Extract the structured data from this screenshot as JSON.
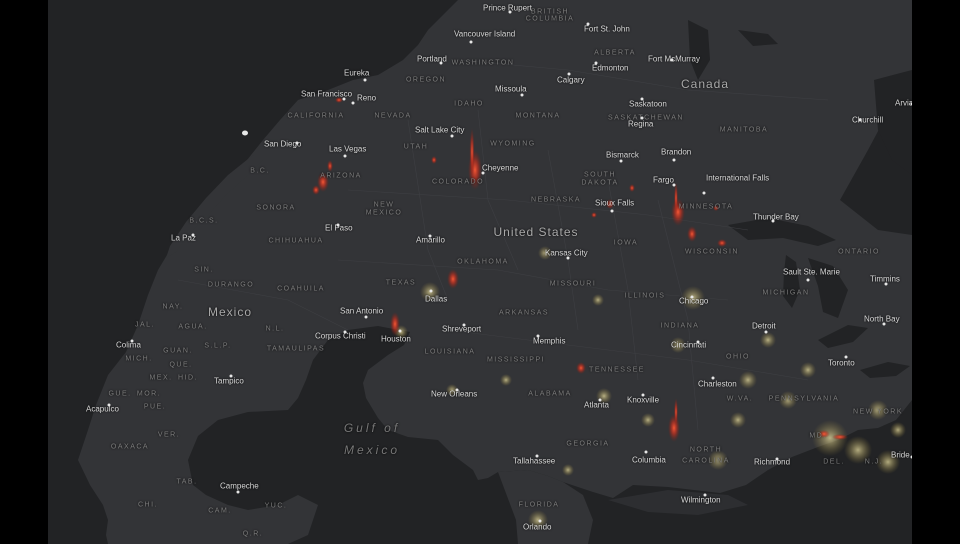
{
  "countries": [
    "Canada",
    "United States",
    "Mexico"
  ],
  "water": [
    "Gulf of",
    "Mexico"
  ],
  "states": [
    "BRITISH",
    "COLUMBIA",
    "ALBERTA",
    "WASHINGTON",
    "OREGON",
    "IDAHO",
    "MONTANA",
    "CALIFORNIA",
    "NEVADA",
    "UTAH",
    "WYOMING",
    "ARIZONA",
    "COLORADO",
    "NEW",
    "MEXICO",
    "SOUTH",
    "DAKOTA",
    "NEBRASKA",
    "IOWA",
    "OKLAHOMA",
    "MISSOURI",
    "ILLINOIS",
    "INDIANA",
    "OHIO",
    "TEXAS",
    "ARKANSAS",
    "TENNESSEE",
    "LOUISIANA",
    "MISSISSIPPI",
    "ALABAMA",
    "GEORGIA",
    "NORTH",
    "CAROLINA",
    "FLORIDA",
    "W.VA.",
    "PENNSYLVANIA",
    "NEW YORK",
    "MD.",
    "DEL.",
    "N.J.",
    "MINNESOTA",
    "WISCONSIN",
    "MICHIGAN",
    "MANITOBA",
    "ONTARIO",
    "SASKATCHEWAN",
    "B.C.S.",
    "SONORA",
    "CHIHUAHUA",
    "SIN.",
    "DURANGO",
    "COAHUILA",
    "NAY.",
    "JAL.",
    "AGUA.",
    "S.L.P.",
    "TAMAULIPAS",
    "N.L.",
    "MICH.",
    "GUAN.",
    "QUE.",
    "MEX.",
    "HID.",
    "GUE.",
    "MOR.",
    "PUE.",
    "OAXACA",
    "VER.",
    "TAB.",
    "CHI.",
    "CAM.",
    "YUC.",
    "Q.R.",
    "B.C."
  ],
  "cities": [
    "Prince Rupert",
    "Fort St. John",
    "Vancouver Island",
    "Portland",
    "Edmonton",
    "Fort McMurray",
    "Eureka",
    "Missoula",
    "Calgary",
    "San Francisco",
    "Reno",
    "Saskatoon",
    "Regina",
    "Salt Lake City",
    "Churchill",
    "San Diego",
    "Las Vegas",
    "Cheyenne",
    "Bismarck",
    "Brandon",
    "Fargo",
    "International Falls",
    "Sioux Falls",
    "Thunder Bay",
    "El Paso",
    "La Paz",
    "Amarillo",
    "Kansas City",
    "Sault Ste. Marie",
    "Timmins",
    "Dallas",
    "Chicago",
    "San Antonio",
    "Shreveport",
    "Detroit",
    "North Bay",
    "Colima",
    "Corpus Christi",
    "Houston",
    "Memphis",
    "Cincinnati",
    "Toronto",
    "Tampico",
    "Charleston",
    "New Orleans",
    "Knoxville",
    "Acapulco",
    "Atlanta",
    "Tallahassee",
    "Columbia",
    "Richmond",
    "Campeche",
    "Wilmington",
    "Orlando",
    "Arviat",
    "Bride"
  ],
  "heat_color": "#e8321e",
  "light_color": "#d6c98a",
  "land_color": "#333437",
  "sea_color": "#222325"
}
